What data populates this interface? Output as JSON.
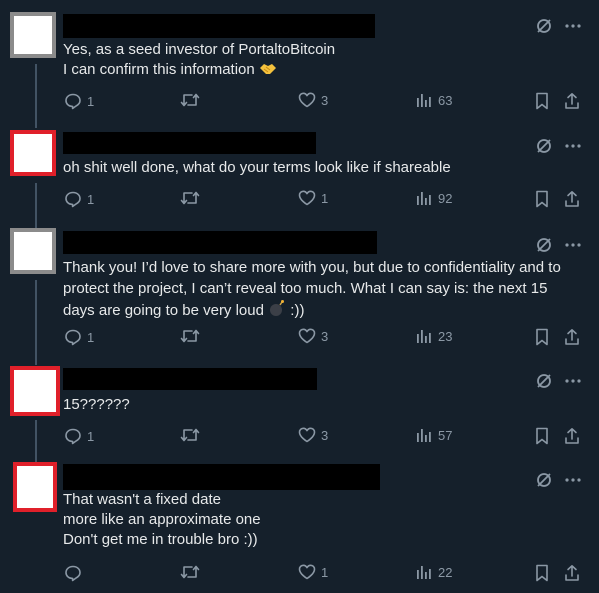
{
  "tweets": [
    {
      "lines": [
        "Yes, as a seed investor of PortaltoBitcoin",
        "I can confirm this information"
      ],
      "emoji": "handshake-emoji",
      "replies": "1",
      "retweets": "",
      "likes": "3",
      "views": "63"
    },
    {
      "lines": [
        "oh shit well done, what do your terms look like if shareable"
      ],
      "replies": "1",
      "retweets": "",
      "likes": "1",
      "views": "92"
    },
    {
      "lines": [
        "Thank you! I’d love to share more with you, but due to confidentiality and to",
        "protect the project, I can’t reveal too much. What I can say is: the next 15",
        "days are going to be very loud",
        " :))"
      ],
      "emoji": "bomb-emoji",
      "replies": "1",
      "retweets": "",
      "likes": "3",
      "views": "23"
    },
    {
      "lines": [
        "15??????"
      ],
      "replies": "1",
      "retweets": "",
      "likes": "3",
      "views": "57"
    },
    {
      "lines": [
        "That wasn't a fixed date",
        "more like an approximate one",
        "Don't get me in trouble bro :))"
      ],
      "replies": "",
      "retweets": "",
      "likes": "1",
      "views": "22"
    }
  ],
  "icons": {
    "reply": "reply-icon",
    "retweet": "retweet-icon",
    "like": "heart-icon",
    "views": "views-icon",
    "bookmark": "bookmark-icon",
    "share": "share-icon",
    "grok": "grok-icon",
    "more": "more-icon"
  },
  "colors": {
    "background": "#15202b",
    "text": "#e7e9ea",
    "muted": "#8b98a5",
    "border_red": "#e0202a"
  }
}
